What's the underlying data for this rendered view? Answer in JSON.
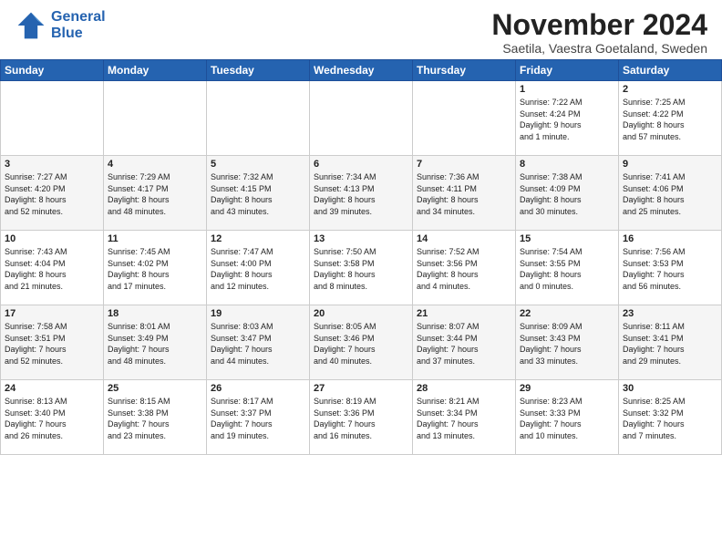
{
  "header": {
    "logo_line1": "General",
    "logo_line2": "Blue",
    "month": "November 2024",
    "location": "Saetila, Vaestra Goetaland, Sweden"
  },
  "days_of_week": [
    "Sunday",
    "Monday",
    "Tuesday",
    "Wednesday",
    "Thursday",
    "Friday",
    "Saturday"
  ],
  "weeks": [
    [
      {
        "day": "",
        "info": ""
      },
      {
        "day": "",
        "info": ""
      },
      {
        "day": "",
        "info": ""
      },
      {
        "day": "",
        "info": ""
      },
      {
        "day": "",
        "info": ""
      },
      {
        "day": "1",
        "info": "Sunrise: 7:22 AM\nSunset: 4:24 PM\nDaylight: 9 hours\nand 1 minute."
      },
      {
        "day": "2",
        "info": "Sunrise: 7:25 AM\nSunset: 4:22 PM\nDaylight: 8 hours\nand 57 minutes."
      }
    ],
    [
      {
        "day": "3",
        "info": "Sunrise: 7:27 AM\nSunset: 4:20 PM\nDaylight: 8 hours\nand 52 minutes."
      },
      {
        "day": "4",
        "info": "Sunrise: 7:29 AM\nSunset: 4:17 PM\nDaylight: 8 hours\nand 48 minutes."
      },
      {
        "day": "5",
        "info": "Sunrise: 7:32 AM\nSunset: 4:15 PM\nDaylight: 8 hours\nand 43 minutes."
      },
      {
        "day": "6",
        "info": "Sunrise: 7:34 AM\nSunset: 4:13 PM\nDaylight: 8 hours\nand 39 minutes."
      },
      {
        "day": "7",
        "info": "Sunrise: 7:36 AM\nSunset: 4:11 PM\nDaylight: 8 hours\nand 34 minutes."
      },
      {
        "day": "8",
        "info": "Sunrise: 7:38 AM\nSunset: 4:09 PM\nDaylight: 8 hours\nand 30 minutes."
      },
      {
        "day": "9",
        "info": "Sunrise: 7:41 AM\nSunset: 4:06 PM\nDaylight: 8 hours\nand 25 minutes."
      }
    ],
    [
      {
        "day": "10",
        "info": "Sunrise: 7:43 AM\nSunset: 4:04 PM\nDaylight: 8 hours\nand 21 minutes."
      },
      {
        "day": "11",
        "info": "Sunrise: 7:45 AM\nSunset: 4:02 PM\nDaylight: 8 hours\nand 17 minutes."
      },
      {
        "day": "12",
        "info": "Sunrise: 7:47 AM\nSunset: 4:00 PM\nDaylight: 8 hours\nand 12 minutes."
      },
      {
        "day": "13",
        "info": "Sunrise: 7:50 AM\nSunset: 3:58 PM\nDaylight: 8 hours\nand 8 minutes."
      },
      {
        "day": "14",
        "info": "Sunrise: 7:52 AM\nSunset: 3:56 PM\nDaylight: 8 hours\nand 4 minutes."
      },
      {
        "day": "15",
        "info": "Sunrise: 7:54 AM\nSunset: 3:55 PM\nDaylight: 8 hours\nand 0 minutes."
      },
      {
        "day": "16",
        "info": "Sunrise: 7:56 AM\nSunset: 3:53 PM\nDaylight: 7 hours\nand 56 minutes."
      }
    ],
    [
      {
        "day": "17",
        "info": "Sunrise: 7:58 AM\nSunset: 3:51 PM\nDaylight: 7 hours\nand 52 minutes."
      },
      {
        "day": "18",
        "info": "Sunrise: 8:01 AM\nSunset: 3:49 PM\nDaylight: 7 hours\nand 48 minutes."
      },
      {
        "day": "19",
        "info": "Sunrise: 8:03 AM\nSunset: 3:47 PM\nDaylight: 7 hours\nand 44 minutes."
      },
      {
        "day": "20",
        "info": "Sunrise: 8:05 AM\nSunset: 3:46 PM\nDaylight: 7 hours\nand 40 minutes."
      },
      {
        "day": "21",
        "info": "Sunrise: 8:07 AM\nSunset: 3:44 PM\nDaylight: 7 hours\nand 37 minutes."
      },
      {
        "day": "22",
        "info": "Sunrise: 8:09 AM\nSunset: 3:43 PM\nDaylight: 7 hours\nand 33 minutes."
      },
      {
        "day": "23",
        "info": "Sunrise: 8:11 AM\nSunset: 3:41 PM\nDaylight: 7 hours\nand 29 minutes."
      }
    ],
    [
      {
        "day": "24",
        "info": "Sunrise: 8:13 AM\nSunset: 3:40 PM\nDaylight: 7 hours\nand 26 minutes."
      },
      {
        "day": "25",
        "info": "Sunrise: 8:15 AM\nSunset: 3:38 PM\nDaylight: 7 hours\nand 23 minutes."
      },
      {
        "day": "26",
        "info": "Sunrise: 8:17 AM\nSunset: 3:37 PM\nDaylight: 7 hours\nand 19 minutes."
      },
      {
        "day": "27",
        "info": "Sunrise: 8:19 AM\nSunset: 3:36 PM\nDaylight: 7 hours\nand 16 minutes."
      },
      {
        "day": "28",
        "info": "Sunrise: 8:21 AM\nSunset: 3:34 PM\nDaylight: 7 hours\nand 13 minutes."
      },
      {
        "day": "29",
        "info": "Sunrise: 8:23 AM\nSunset: 3:33 PM\nDaylight: 7 hours\nand 10 minutes."
      },
      {
        "day": "30",
        "info": "Sunrise: 8:25 AM\nSunset: 3:32 PM\nDaylight: 7 hours\nand 7 minutes."
      }
    ]
  ]
}
